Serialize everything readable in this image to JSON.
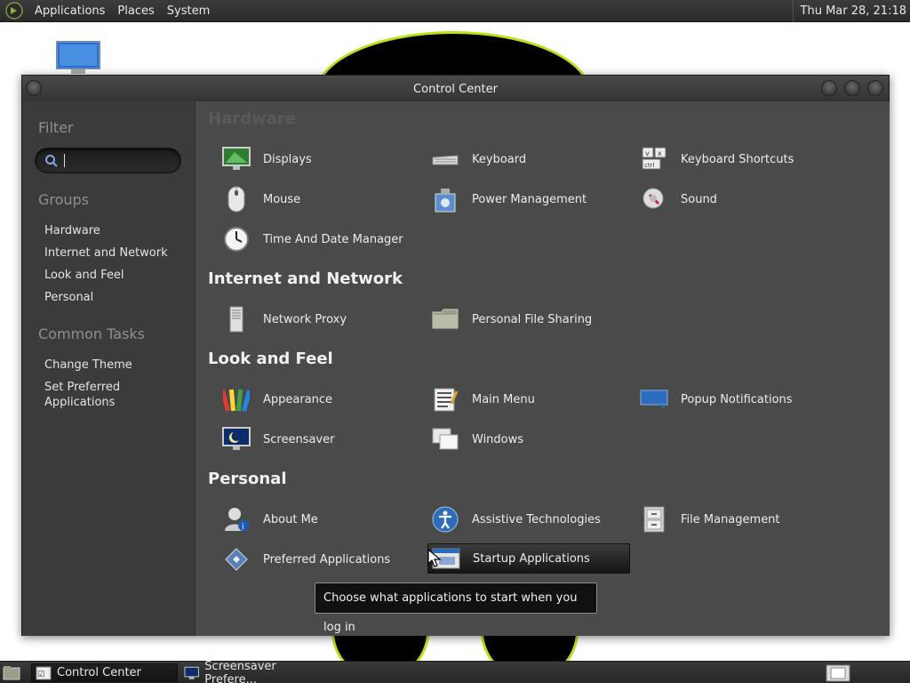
{
  "top_panel": {
    "menus": [
      "Applications",
      "Places",
      "System"
    ],
    "clock": "Thu Mar 28, 21:18"
  },
  "window": {
    "title": "Control Center"
  },
  "sidebar": {
    "filter_heading": "Filter",
    "search_value": "",
    "groups_heading": "Groups",
    "groups": [
      "Hardware",
      "Internet and Network",
      "Look and Feel",
      "Personal"
    ],
    "tasks_heading": "Common Tasks",
    "tasks": [
      "Change Theme",
      "Set Preferred Applications"
    ]
  },
  "content": {
    "sections": {
      "hardware": {
        "title": "Hardware",
        "items": [
          "Displays",
          "Keyboard",
          "Keyboard Shortcuts",
          "Mouse",
          "Power Management",
          "Sound",
          "Time And Date Manager"
        ]
      },
      "internet": {
        "title": "Internet and Network",
        "items": [
          "Network Proxy",
          "Personal File Sharing"
        ]
      },
      "look": {
        "title": "Look and Feel",
        "items": [
          "Appearance",
          "Main Menu",
          "Popup Notifications",
          "Screensaver",
          "Windows"
        ]
      },
      "personal": {
        "title": "Personal",
        "items": [
          "About Me",
          "Assistive Technologies",
          "File Management",
          "Preferred Applications",
          "Startup Applications"
        ]
      }
    },
    "hovered_item": "Startup Applications"
  },
  "tooltip": {
    "text": "Choose what applications to start when you log in"
  },
  "taskbar": {
    "tasks": [
      "Control Center",
      "Screensaver Prefere..."
    ]
  },
  "colors": {
    "accent_ring": "#b9e21a",
    "window_bg": "#3b3b3b",
    "content_bg": "#4a4a4a"
  }
}
